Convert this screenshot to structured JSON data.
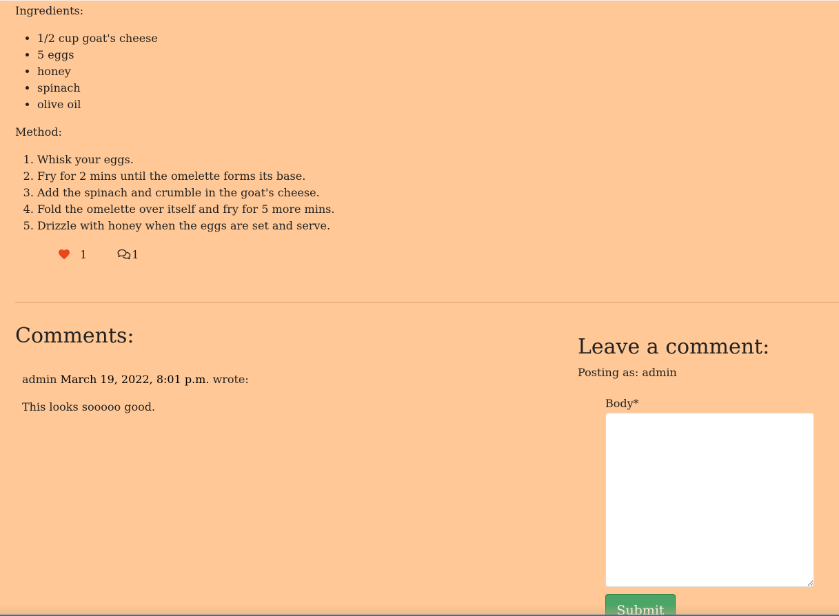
{
  "recipe": {
    "ingredients_label": "Ingredients:",
    "ingredients": [
      "1/2 cup goat's cheese",
      "5 eggs",
      "honey",
      "spinach",
      "olive oil"
    ],
    "method_label": "Method:",
    "method": [
      "Whisk your eggs.",
      "Fry for 2 mins until the omelette forms its base.",
      "Add the spinach and crumble in the goat's cheese.",
      "Fold the omelette over itself and fry for 5 more mins.",
      "Drizzle with honey when the eggs are set and serve."
    ]
  },
  "reactions": {
    "like_count": "1",
    "comment_count": "1",
    "like_color": "#e8461c"
  },
  "comments": {
    "heading": "Comments:",
    "items": [
      {
        "author": "admin",
        "date": "March 19, 2022, 8:01 p.m.",
        "wrote": "wrote:",
        "body": "This looks sooooo good."
      }
    ]
  },
  "comment_form": {
    "heading": "Leave a comment:",
    "posting_as": "Posting as: admin",
    "body_label": "Body*",
    "body_value": "",
    "submit_label": "Submit",
    "submit_color": "#4aa566"
  }
}
